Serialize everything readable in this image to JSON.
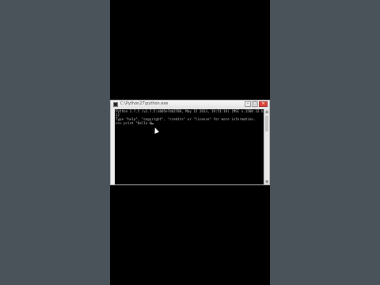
{
  "window": {
    "title": "C:\\Python27\\python.exe",
    "controls": [
      "–",
      "□",
      "✕"
    ]
  },
  "console": {
    "lines": [
      "Python 2.7.5 (v2.7.5:ab05e7dd2788, May 15 2013, 19:51:19) [MSC v.1500 32 bit (Intel)] on win",
      "32",
      "Type \"help\", \"copyright\", \"credits\" or \"license\" for more information.",
      ">>> print \"Hello W"
    ]
  },
  "icons": {
    "app": "terminal-icon",
    "cursor": "mouse-pointer-icon"
  },
  "colors": {
    "page_background": "#4a5359",
    "console_background": "#000000",
    "console_text": "#c8c8c8"
  }
}
